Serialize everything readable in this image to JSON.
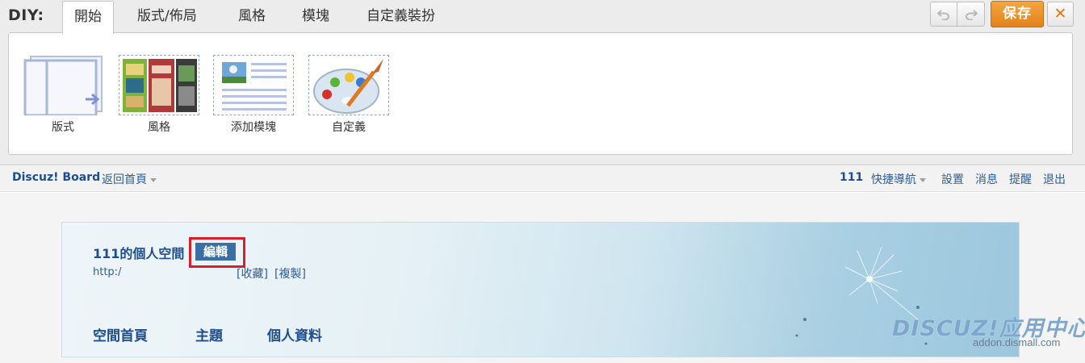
{
  "diy": {
    "label": "DIY:",
    "tabs": [
      "開始",
      "版式/佈局",
      "風格",
      "模塊",
      "自定義裝扮"
    ],
    "save_label": "保存",
    "close_label": "✕",
    "undo_icon": "undo-icon",
    "redo_icon": "redo-icon",
    "items": [
      {
        "label": "版式",
        "icon": "layout-icon"
      },
      {
        "label": "風格",
        "icon": "style-thumbnail-icon"
      },
      {
        "label": "添加模塊",
        "icon": "add-module-icon"
      },
      {
        "label": "自定義",
        "icon": "palette-icon"
      }
    ],
    "colors": {
      "save": "#e8881f",
      "close": "#e27715"
    }
  },
  "topbar": {
    "site_name": "Discuz! Board",
    "home_link": "返回首頁",
    "username": "111",
    "quick_nav": "快捷導航",
    "settings": "設置",
    "messages": "消息",
    "reminders": "提醒",
    "logout": "退出"
  },
  "space": {
    "title": "111的個人空間",
    "edit_label": "編輯",
    "url": "http:/",
    "favorite": "[收藏]",
    "copy": "[複製]",
    "nav": [
      "空間首頁",
      "主題",
      "個人資料"
    ]
  },
  "watermark": {
    "logo": "DISCUZ!应用中心",
    "url": "addon.dismall.com"
  }
}
